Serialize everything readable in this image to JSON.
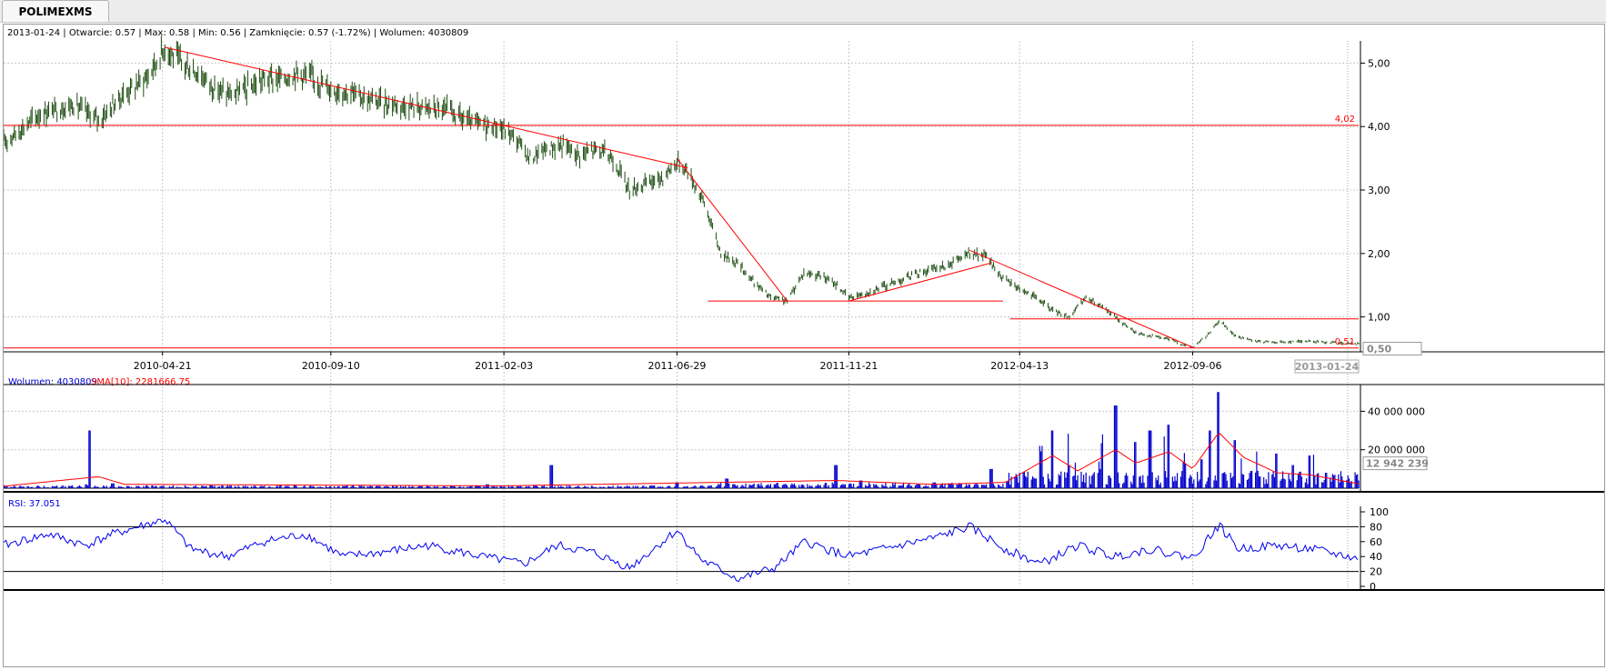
{
  "tab": {
    "label": "POLIMEXMS"
  },
  "info_line": "2013-01-24 | Otwarcie: 0.57 | Max: 0.58 | Min: 0.56 | Zamknięcie: 0.57 (-1.72%) | Wolumen: 4030809",
  "volume_header": {
    "vol_label": "Wolumen: 4030809",
    "sma_label": "SMA[10]: 2281666.75"
  },
  "rsi_header": "RSI: 37.051",
  "colors": {
    "price": "#1d4d12",
    "trend": "#ff0000",
    "volume": "#0000cc",
    "sma": "#ff0000",
    "rsi": "#0000ee",
    "grid": "#c8c8c8"
  },
  "chart_data": [
    {
      "type": "line",
      "title": "POLIMEXMS",
      "x_ticks": [
        "2010-04-21",
        "2010-09-10",
        "2011-02-03",
        "2011-06-29",
        "2011-11-21",
        "2012-04-13",
        "2012-09-06"
      ],
      "last_date_label": "2013-01-24",
      "y_ticks": [
        "1,00",
        "2,00",
        "3,00",
        "4,00",
        "5,00"
      ],
      "ylim": [
        0.45,
        5.35
      ],
      "last_value_label": "0,50",
      "date_range": [
        "2009-12-08",
        "2013-01-24"
      ],
      "series": [
        {
          "points": [
            [
              "2009-12-08",
              3.75
            ],
            [
              "2010-01-08",
              4.2
            ],
            [
              "2010-02-05",
              4.35
            ],
            [
              "2010-02-26",
              4.1
            ],
            [
              "2010-03-19",
              4.5
            ],
            [
              "2010-04-09",
              4.8
            ],
            [
              "2010-04-23",
              5.25
            ],
            [
              "2010-05-07",
              5.0
            ],
            [
              "2010-05-21",
              4.85
            ],
            [
              "2010-06-04",
              4.6
            ],
            [
              "2010-06-18",
              4.5
            ],
            [
              "2010-07-02",
              4.6
            ],
            [
              "2010-07-16",
              4.75
            ],
            [
              "2010-07-30",
              4.75
            ],
            [
              "2010-08-13",
              4.85
            ],
            [
              "2010-08-27",
              4.75
            ],
            [
              "2010-09-10",
              4.6
            ],
            [
              "2010-09-24",
              4.55
            ],
            [
              "2010-10-15",
              4.4
            ],
            [
              "2010-11-05",
              4.35
            ],
            [
              "2010-11-26",
              4.3
            ],
            [
              "2010-12-17",
              4.25
            ],
            [
              "2011-01-07",
              4.05
            ],
            [
              "2011-01-28",
              4.0
            ],
            [
              "2011-02-11",
              3.85
            ],
            [
              "2011-02-25",
              3.5
            ],
            [
              "2011-03-11",
              3.65
            ],
            [
              "2011-03-25",
              3.7
            ],
            [
              "2011-04-08",
              3.55
            ],
            [
              "2011-04-22",
              3.65
            ],
            [
              "2011-05-06",
              3.5
            ],
            [
              "2011-05-20",
              3.0
            ],
            [
              "2011-06-03",
              3.1
            ],
            [
              "2011-06-17",
              3.2
            ],
            [
              "2011-06-29",
              3.45
            ],
            [
              "2011-07-08",
              3.3
            ],
            [
              "2011-07-22",
              2.8
            ],
            [
              "2011-08-05",
              2.0
            ],
            [
              "2011-08-19",
              1.85
            ],
            [
              "2011-09-02",
              1.55
            ],
            [
              "2011-09-16",
              1.3
            ],
            [
              "2011-09-30",
              1.25
            ],
            [
              "2011-10-14",
              1.7
            ],
            [
              "2011-10-28",
              1.65
            ],
            [
              "2011-11-11",
              1.5
            ],
            [
              "2011-11-21",
              1.3
            ],
            [
              "2011-12-09",
              1.4
            ],
            [
              "2011-12-30",
              1.55
            ],
            [
              "2012-01-20",
              1.7
            ],
            [
              "2012-02-10",
              1.8
            ],
            [
              "2012-03-02",
              2.0
            ],
            [
              "2012-03-16",
              1.95
            ],
            [
              "2012-03-30",
              1.6
            ],
            [
              "2012-04-13",
              1.45
            ],
            [
              "2012-04-27",
              1.3
            ],
            [
              "2012-05-11",
              1.1
            ],
            [
              "2012-05-25",
              1.0
            ],
            [
              "2012-06-08",
              1.3
            ],
            [
              "2012-06-22",
              1.15
            ],
            [
              "2012-07-06",
              0.95
            ],
            [
              "2012-07-20",
              0.75
            ],
            [
              "2012-08-03",
              0.7
            ],
            [
              "2012-08-17",
              0.65
            ],
            [
              "2012-08-31",
              0.55
            ],
            [
              "2012-09-06",
              0.52
            ],
            [
              "2012-09-21",
              0.75
            ],
            [
              "2012-09-28",
              0.95
            ],
            [
              "2012-10-12",
              0.7
            ],
            [
              "2012-10-26",
              0.62
            ],
            [
              "2012-11-16",
              0.6
            ],
            [
              "2012-12-07",
              0.62
            ],
            [
              "2012-12-28",
              0.6
            ],
            [
              "2013-01-24",
              0.57
            ]
          ]
        }
      ],
      "horizontal_lines": [
        {
          "y": 4.02,
          "label": "4,02"
        },
        {
          "y": 0.51,
          "label": "0,51"
        },
        {
          "y": 1.25,
          "from": "2011-07-25",
          "to": "2012-03-30"
        },
        {
          "y": 0.97,
          "from": "2012-04-05",
          "to": "2013-01-24"
        }
      ],
      "trend_lines": [
        {
          "from": [
            "2010-04-23",
            5.25
          ],
          "to": [
            "2011-07-08",
            3.35
          ]
        },
        {
          "from": [
            "2011-06-29",
            3.5
          ],
          "to": [
            "2011-09-30",
            1.25
          ]
        },
        {
          "from": [
            "2011-11-21",
            1.25
          ],
          "to": [
            "2012-03-20",
            1.85
          ]
        },
        {
          "from": [
            "2012-03-02",
            2.05
          ],
          "to": [
            "2012-09-06",
            0.52
          ]
        }
      ]
    },
    {
      "type": "bar",
      "title": "Wolumen",
      "y_ticks": [
        "20 000 000",
        "40 000 000"
      ],
      "ylim": [
        0,
        52000000
      ],
      "last_value_label": "12 942 239",
      "series": [
        {
          "name": "Wolumen",
          "samples": [
            [
              "2009-12-08",
              1500000
            ],
            [
              "2010-02-15",
              2000000
            ],
            [
              "2010-02-19",
              30000000
            ],
            [
              "2010-03-10",
              2500000
            ],
            [
              "2010-06-01",
              1500000
            ],
            [
              "2010-10-15",
              1000000
            ],
            [
              "2011-01-20",
              2000000
            ],
            [
              "2011-03-01",
              1500000
            ],
            [
              "2011-03-15",
              12000000
            ],
            [
              "2011-06-29",
              3000000
            ],
            [
              "2011-08-10",
              5000000
            ],
            [
              "2011-09-20",
              2000000
            ],
            [
              "2011-11-10",
              12000000
            ],
            [
              "2011-12-01",
              4000000
            ],
            [
              "2012-02-01",
              3000000
            ],
            [
              "2012-03-20",
              10000000
            ],
            [
              "2012-04-10",
              6000000
            ],
            [
              "2012-05-01",
              22000000
            ],
            [
              "2012-05-11",
              30000000
            ],
            [
              "2012-05-25",
              12000000
            ],
            [
              "2012-06-20",
              10000000
            ],
            [
              "2012-07-03",
              43000000
            ],
            [
              "2012-07-20",
              24000000
            ],
            [
              "2012-08-01",
              30000000
            ],
            [
              "2012-08-17",
              33000000
            ],
            [
              "2012-08-31",
              13000000
            ],
            [
              "2012-09-14",
              15000000
            ],
            [
              "2012-09-21",
              30000000
            ],
            [
              "2012-09-28",
              50000000
            ],
            [
              "2012-10-12",
              25000000
            ],
            [
              "2012-10-26",
              9000000
            ],
            [
              "2012-11-16",
              18000000
            ],
            [
              "2012-11-30",
              12000000
            ],
            [
              "2012-12-14",
              17000000
            ],
            [
              "2012-12-28",
              8000000
            ],
            [
              "2013-01-24",
              4030809
            ]
          ]
        },
        {
          "name": "SMA[10]",
          "samples": [
            [
              "2009-12-08",
              1000000
            ],
            [
              "2010-02-26",
              6000000
            ],
            [
              "2010-03-20",
              2000000
            ],
            [
              "2011-02-01",
              1200000
            ],
            [
              "2011-11-10",
              4000000
            ],
            [
              "2012-02-01",
              2000000
            ],
            [
              "2012-04-01",
              3000000
            ],
            [
              "2012-05-11",
              17000000
            ],
            [
              "2012-06-01",
              9000000
            ],
            [
              "2012-07-03",
              20000000
            ],
            [
              "2012-07-20",
              13000000
            ],
            [
              "2012-08-17",
              19000000
            ],
            [
              "2012-09-06",
              10000000
            ],
            [
              "2012-09-28",
              29000000
            ],
            [
              "2012-10-19",
              16000000
            ],
            [
              "2012-11-16",
              8000000
            ],
            [
              "2012-12-14",
              7000000
            ],
            [
              "2013-01-24",
              2281667
            ]
          ]
        }
      ]
    },
    {
      "type": "line",
      "title": "RSI",
      "y_ticks": [
        "0",
        "20",
        "40",
        "60",
        "80",
        "100"
      ],
      "ylim": [
        0,
        100
      ],
      "reference_lines": [
        20,
        80
      ],
      "series": [
        {
          "name": "RSI",
          "samples": [
            [
              "2009-12-08",
              55
            ],
            [
              "2010-01-15",
              70
            ],
            [
              "2010-02-15",
              55
            ],
            [
              "2010-03-10",
              70
            ],
            [
              "2010-04-23",
              90
            ],
            [
              "2010-05-15",
              50
            ],
            [
              "2010-06-15",
              40
            ],
            [
              "2010-07-15",
              60
            ],
            [
              "2010-08-20",
              70
            ],
            [
              "2010-09-20",
              40
            ],
            [
              "2010-10-20",
              45
            ],
            [
              "2010-12-01",
              55
            ],
            [
              "2011-01-15",
              40
            ],
            [
              "2011-02-20",
              30
            ],
            [
              "2011-03-20",
              55
            ],
            [
              "2011-04-20",
              45
            ],
            [
              "2011-05-20",
              25
            ],
            [
              "2011-06-29",
              75
            ],
            [
              "2011-07-20",
              35
            ],
            [
              "2011-08-20",
              10
            ],
            [
              "2011-09-20",
              25
            ],
            [
              "2011-10-15",
              60
            ],
            [
              "2011-11-20",
              40
            ],
            [
              "2011-12-20",
              50
            ],
            [
              "2012-02-01",
              65
            ],
            [
              "2012-03-02",
              80
            ],
            [
              "2012-04-01",
              50
            ],
            [
              "2012-05-01",
              30
            ],
            [
              "2012-06-01",
              55
            ],
            [
              "2012-07-01",
              40
            ],
            [
              "2012-08-01",
              50
            ],
            [
              "2012-09-06",
              38
            ],
            [
              "2012-09-28",
              82
            ],
            [
              "2012-10-15",
              50
            ],
            [
              "2012-11-15",
              55
            ],
            [
              "2012-12-15",
              50
            ],
            [
              "2013-01-24",
              37
            ]
          ]
        }
      ]
    }
  ]
}
